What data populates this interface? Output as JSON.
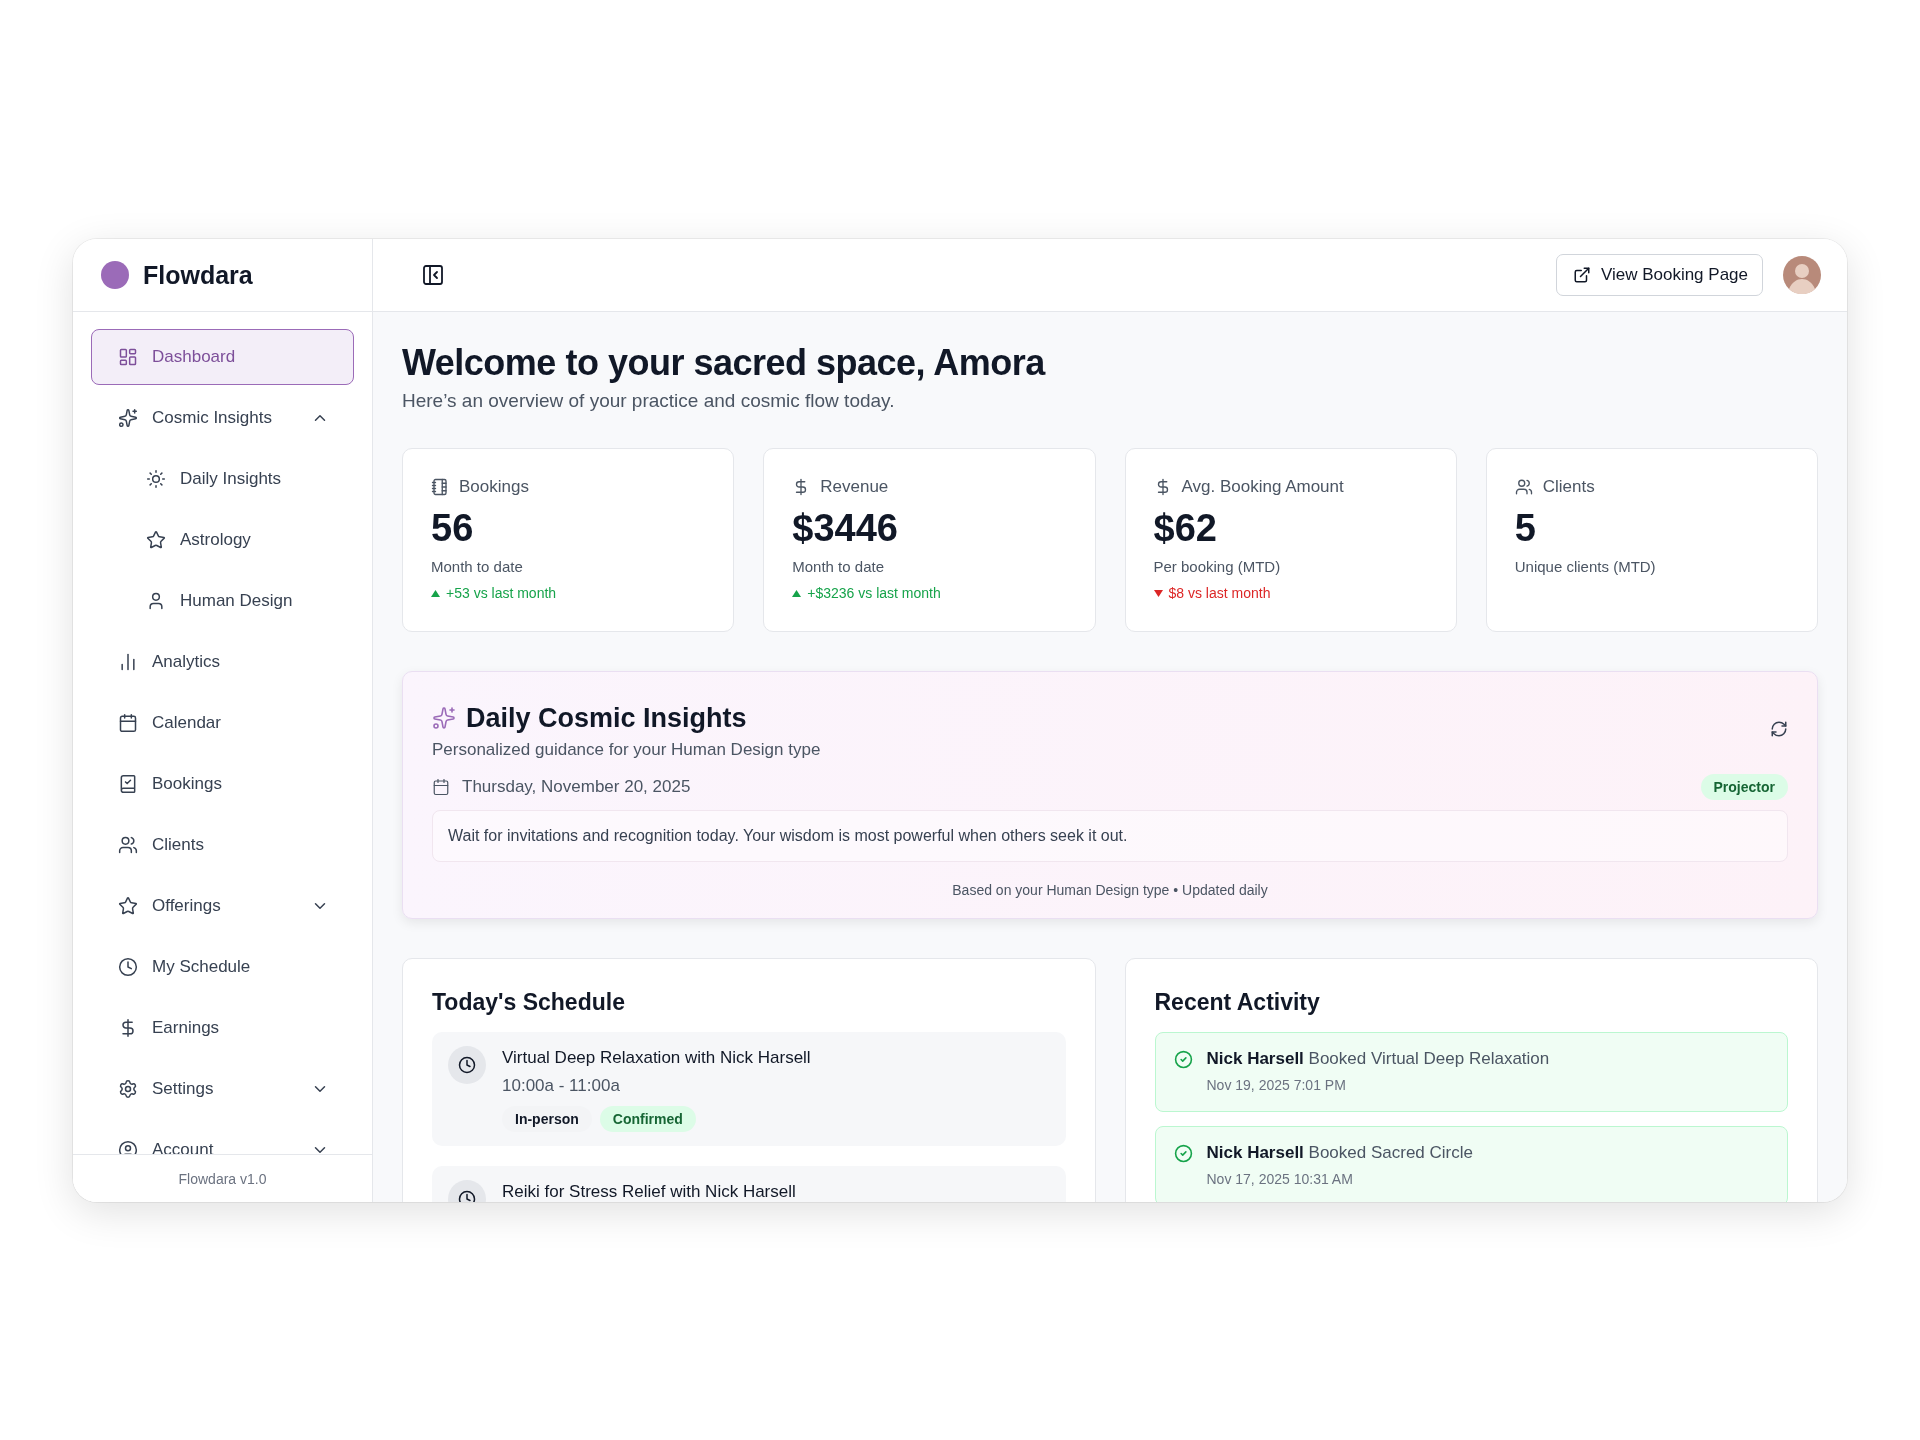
{
  "brand": {
    "name": "Flowdara",
    "version": "Flowdara v1.0"
  },
  "sidebar": {
    "items": [
      {
        "label": "Dashboard",
        "selected": true
      },
      {
        "label": "Cosmic Insights",
        "selected": false,
        "expanded": true,
        "children": [
          {
            "label": "Daily Insights",
            "selected": false
          },
          {
            "label": "Astrology",
            "selected": false
          },
          {
            "label": "Human Design",
            "selected": false
          }
        ]
      },
      {
        "label": "Analytics",
        "selected": false
      },
      {
        "label": "Calendar",
        "selected": false
      },
      {
        "label": "Bookings",
        "selected": false
      },
      {
        "label": "Clients",
        "selected": false
      },
      {
        "label": "Offerings",
        "selected": false,
        "expanded": false
      },
      {
        "label": "My Schedule",
        "selected": false
      },
      {
        "label": "Earnings",
        "selected": false
      },
      {
        "label": "Settings",
        "selected": false,
        "expanded": false
      },
      {
        "label": "Account",
        "selected": false,
        "expanded": false
      }
    ]
  },
  "header": {
    "button": "View Booking Page"
  },
  "welcome": {
    "title": "Welcome to your sacred space, Amora",
    "subtitle": "Here’s an overview of your practice and cosmic flow today."
  },
  "stats": [
    {
      "label": "Bookings",
      "value": "56",
      "note": "Month to date",
      "delta": {
        "text": "+53 vs last month",
        "kind": "up"
      }
    },
    {
      "label": "Revenue",
      "value": "$3446",
      "note": "Month to date",
      "delta": {
        "text": "+$3236 vs last month",
        "kind": "up"
      }
    },
    {
      "label": "Avg. Booking Amount",
      "value": "$62",
      "note": "Per booking (MTD)",
      "delta": {
        "text": "$8 vs last month",
        "kind": "down"
      }
    },
    {
      "label": "Clients",
      "value": "5",
      "note": "Unique clients (MTD)"
    }
  ],
  "insights": {
    "title": "Daily Cosmic Insights",
    "subtitle": "Personalized guidance for your Human Design type",
    "date": "Thursday, November 20, 2025",
    "badge": "Projector",
    "message": "Wait for invitations and recognition today. Your wisdom is most powerful when others seek it out.",
    "footer": "Based on your Human Design type • Updated daily"
  },
  "schedule": {
    "title": "Today's Schedule",
    "items": [
      {
        "title": "Virtual Deep Relaxation with Nick Harsell",
        "time": "10:00a - 11:00a",
        "tags": [
          {
            "label": "In-person",
            "kind": "mode"
          },
          {
            "label": "Confirmed",
            "kind": "status"
          }
        ]
      },
      {
        "title": "Reiki for Stress Relief with Nick Harsell"
      }
    ]
  },
  "activity": {
    "title": "Recent Activity",
    "items": [
      {
        "name": "Nick Harsell",
        "action": "Booked Virtual Deep Relaxation",
        "time": "Nov 19, 2025 7:01 PM"
      },
      {
        "name": "Nick Harsell",
        "action": "Booked Sacred Circle",
        "time": "Nov 17, 2025 10:31 AM"
      }
    ]
  }
}
